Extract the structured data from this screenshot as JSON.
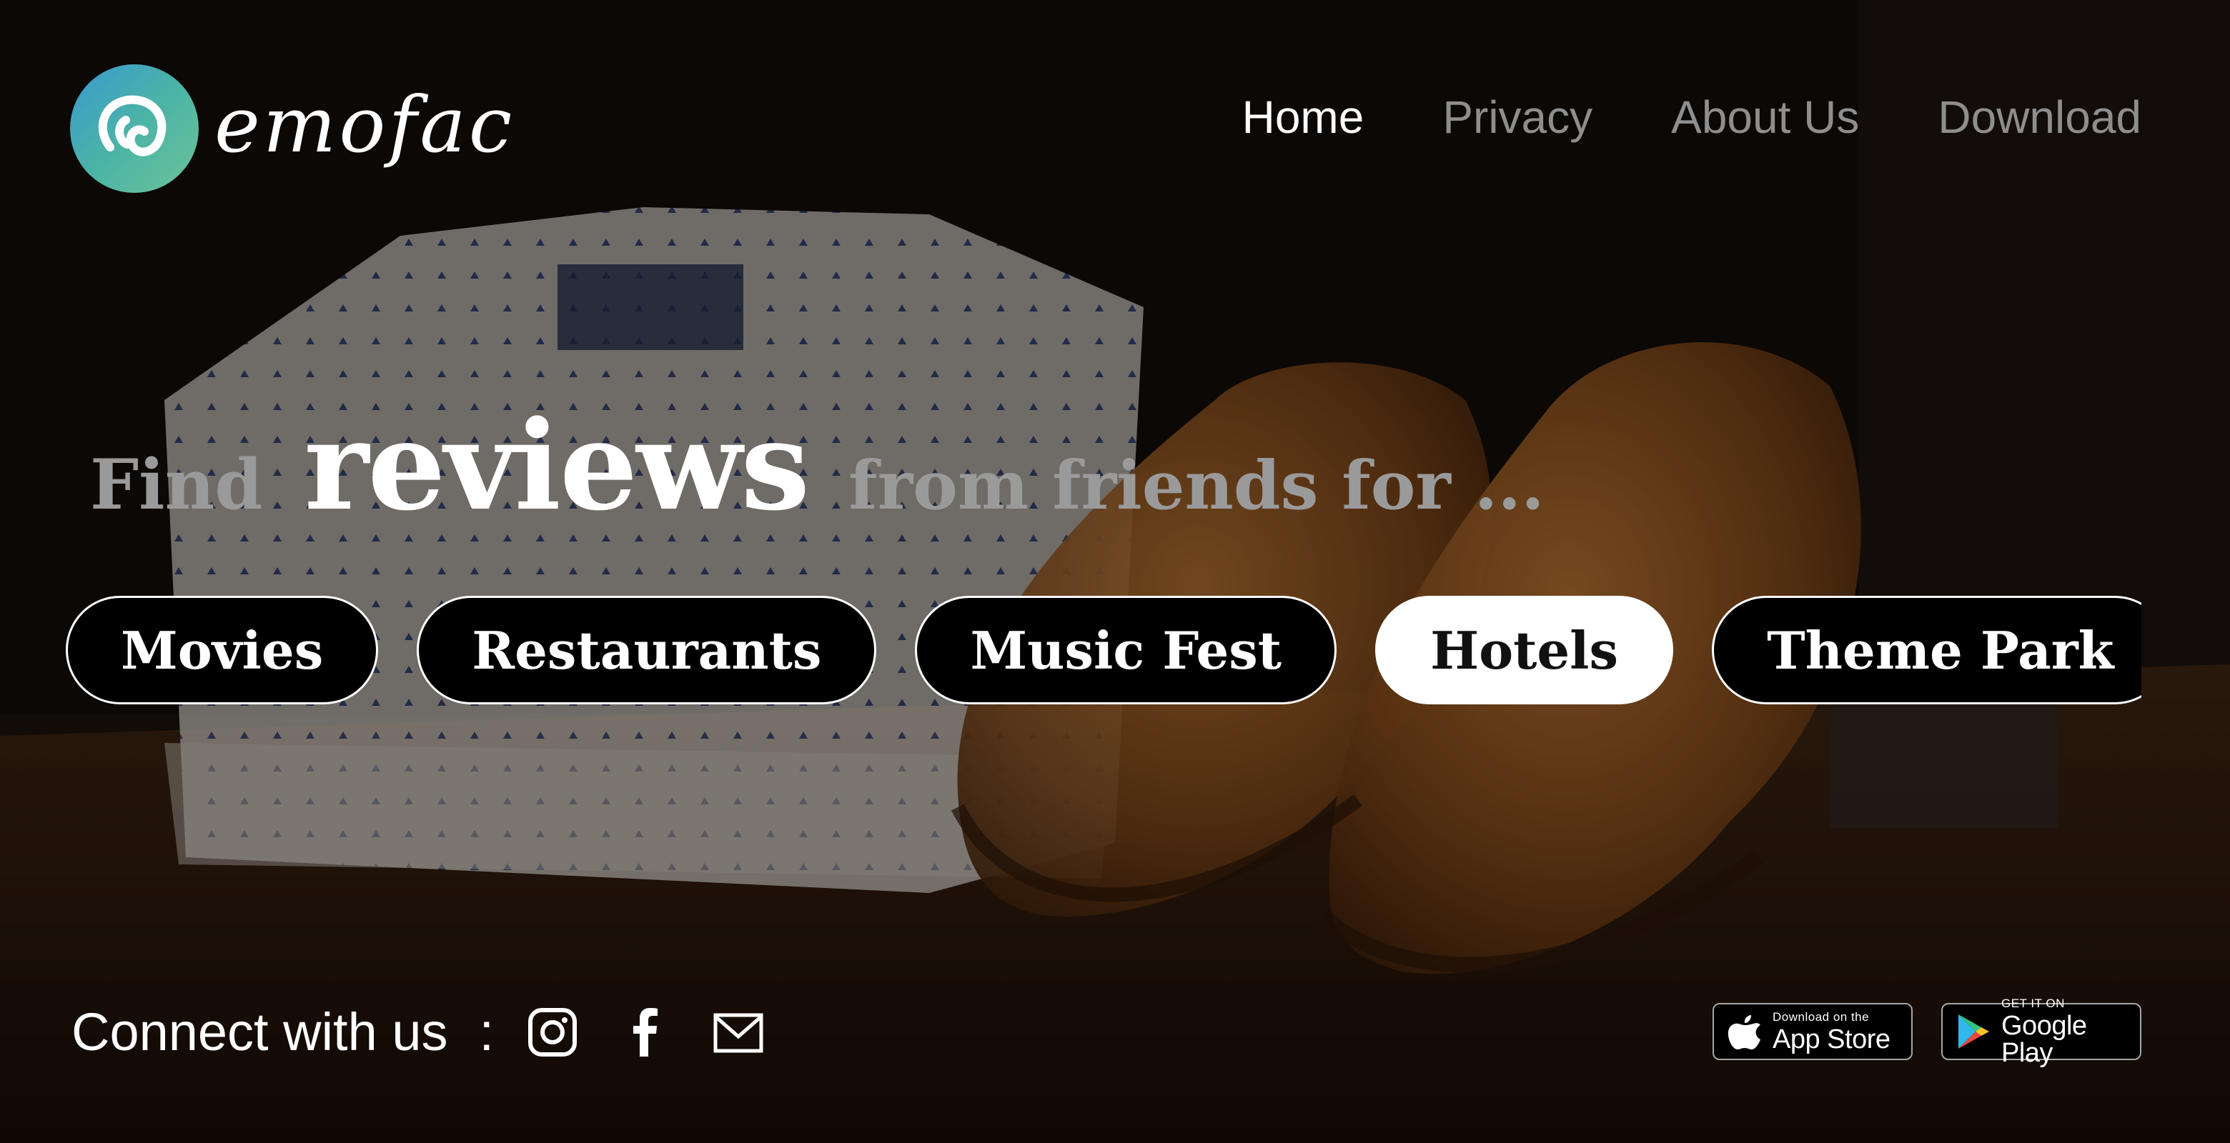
{
  "brand": {
    "name": "emofac",
    "logo_color": "#4bb3a6"
  },
  "nav": {
    "items": [
      {
        "label": "Home",
        "active": true
      },
      {
        "label": "Privacy",
        "active": false
      },
      {
        "label": "About Us",
        "active": false
      },
      {
        "label": "Download",
        "active": false
      }
    ]
  },
  "headline": {
    "prefix": "Find",
    "emphasis": "reviews",
    "suffix": "from friends for ..."
  },
  "categories": {
    "items": [
      "Movies",
      "Restaurants",
      "Music Fest",
      "Hotels",
      "Theme Park"
    ],
    "selected": "Hotels"
  },
  "footer": {
    "connect_label": "Connect with us",
    "separator": ":",
    "social_icons": [
      "instagram-icon",
      "facebook-icon",
      "mail-icon"
    ],
    "app_store": {
      "small": "Download on the",
      "big": "App Store"
    },
    "google_play": {
      "small": "GET IT ON",
      "big": "Google Play"
    }
  }
}
